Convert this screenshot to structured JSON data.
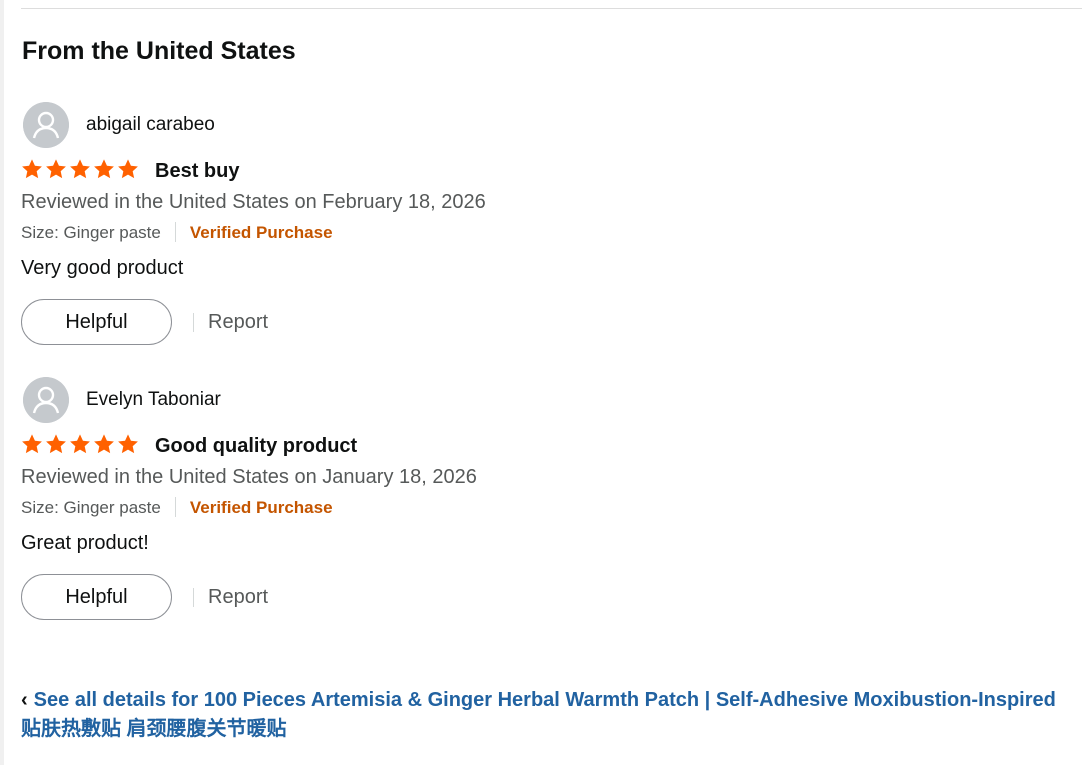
{
  "section_title": "From the United States",
  "colors": {
    "star": "#ff6100",
    "verified": "#c45500",
    "link": "#2162a1"
  },
  "reviews": [
    {
      "author": "abigail carabeo",
      "rating": 5,
      "title": "Best buy",
      "date": "Reviewed in the United States on February 18, 2026",
      "size": "Size: Ginger paste",
      "verified": "Verified Purchase",
      "body": "Very good product",
      "helpful_label": "Helpful",
      "report_label": "Report"
    },
    {
      "author": "Evelyn Taboniar",
      "rating": 5,
      "title": "Good quality product",
      "date": "Reviewed in the United States on January 18, 2026",
      "size": "Size: Ginger paste",
      "verified": "Verified Purchase",
      "body": "Great product!",
      "helpful_label": "Helpful",
      "report_label": "Report"
    }
  ],
  "see_all": {
    "chevron": "‹",
    "line1": "See all details for 100 Pieces Artemisia & Ginger Herbal Warmth Patch | Self-Adhesive Moxibustion-Inspired",
    "line2": "贴肤热敷贴 肩颈腰腹关节暖贴"
  }
}
